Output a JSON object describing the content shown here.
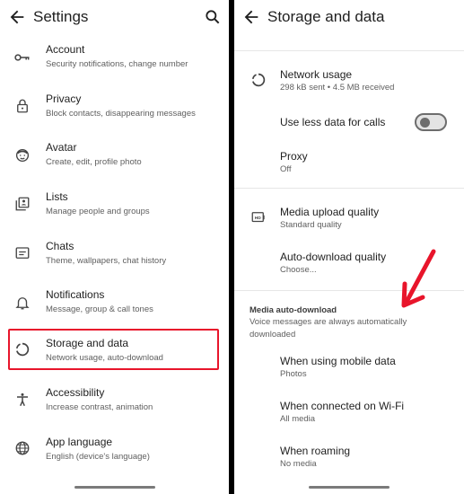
{
  "left": {
    "title": "Settings",
    "items": [
      {
        "label": "Account",
        "sub": "Security notifications, change number",
        "icon": "key-icon"
      },
      {
        "label": "Privacy",
        "sub": "Block contacts, disappearing messages",
        "icon": "lock-icon"
      },
      {
        "label": "Avatar",
        "sub": "Create, edit, profile photo",
        "icon": "avatar-icon"
      },
      {
        "label": "Lists",
        "sub": "Manage people and groups",
        "icon": "lists-icon"
      },
      {
        "label": "Chats",
        "sub": "Theme, wallpapers, chat history",
        "icon": "chat-icon"
      },
      {
        "label": "Notifications",
        "sub": "Message, group & call tones",
        "icon": "bell-icon"
      },
      {
        "label": "Storage and data",
        "sub": "Network usage, auto-download",
        "icon": "storage-icon"
      },
      {
        "label": "Accessibility",
        "sub": "Increase contrast, animation",
        "icon": "accessibility-icon"
      },
      {
        "label": "App language",
        "sub": "English (device's language)",
        "icon": "globe-icon"
      }
    ]
  },
  "right": {
    "title": "Storage and data",
    "network_usage": {
      "label": "Network usage",
      "sub": "298 kB sent • 4.5 MB received"
    },
    "less_data": {
      "label": "Use less data for calls",
      "on": false
    },
    "proxy": {
      "label": "Proxy",
      "sub": "Off"
    },
    "media_upload": {
      "label": "Media upload quality",
      "sub": "Standard quality"
    },
    "auto_download_quality": {
      "label": "Auto-download quality",
      "sub": "Choose..."
    },
    "section": {
      "label": "Media auto-download",
      "desc": "Voice messages are always automatically downloaded"
    },
    "mobile_data": {
      "label": "When using mobile data",
      "sub": "Photos"
    },
    "wifi": {
      "label": "When connected on Wi-Fi",
      "sub": "All media"
    },
    "roaming": {
      "label": "When roaming",
      "sub": "No media"
    }
  },
  "colors": {
    "highlight": "#e8152b",
    "arrow": "#e8152b"
  }
}
